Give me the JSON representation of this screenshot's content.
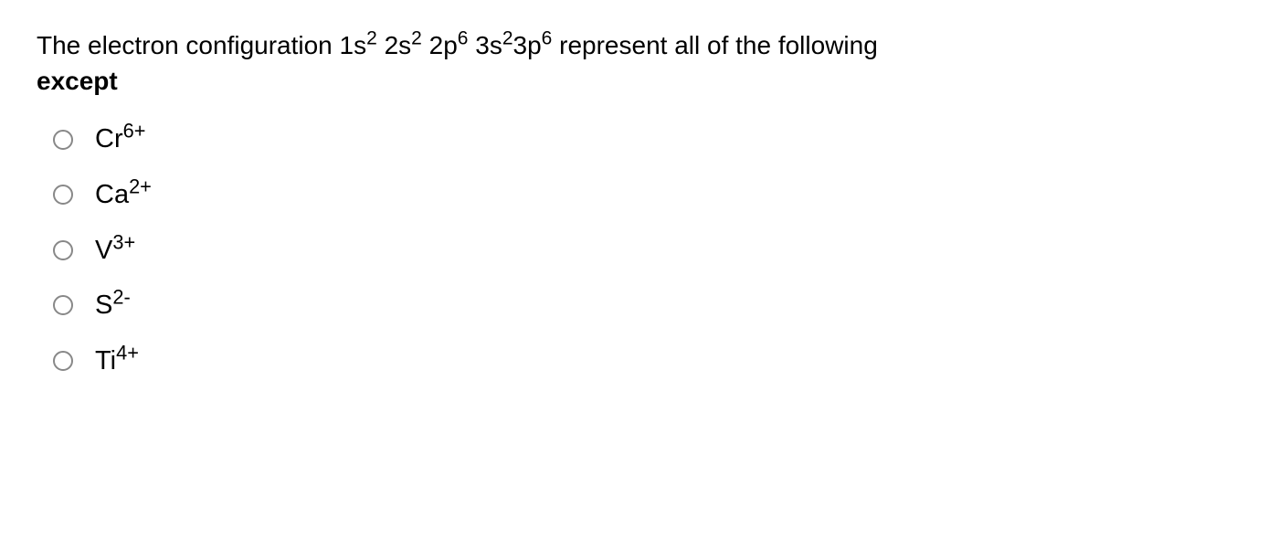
{
  "question": {
    "prefix": "The electron configuration ",
    "config_parts": [
      {
        "base": "1s",
        "sup": "2"
      },
      {
        "base": "2s",
        "sup": "2"
      },
      {
        "base": "2p",
        "sup": "6"
      },
      {
        "base": "3s",
        "sup": "2"
      },
      {
        "base": "3p",
        "sup": "6"
      }
    ],
    "middle": "  represent all of the following ",
    "except_word": "except"
  },
  "options": [
    {
      "base": "Cr",
      "sup": "6+"
    },
    {
      "base": "Ca",
      "sup": "2+"
    },
    {
      "base": "V",
      "sup": "3+"
    },
    {
      "base": "S",
      "sup": "2-"
    },
    {
      "base": "Ti",
      "sup": "4+"
    }
  ]
}
